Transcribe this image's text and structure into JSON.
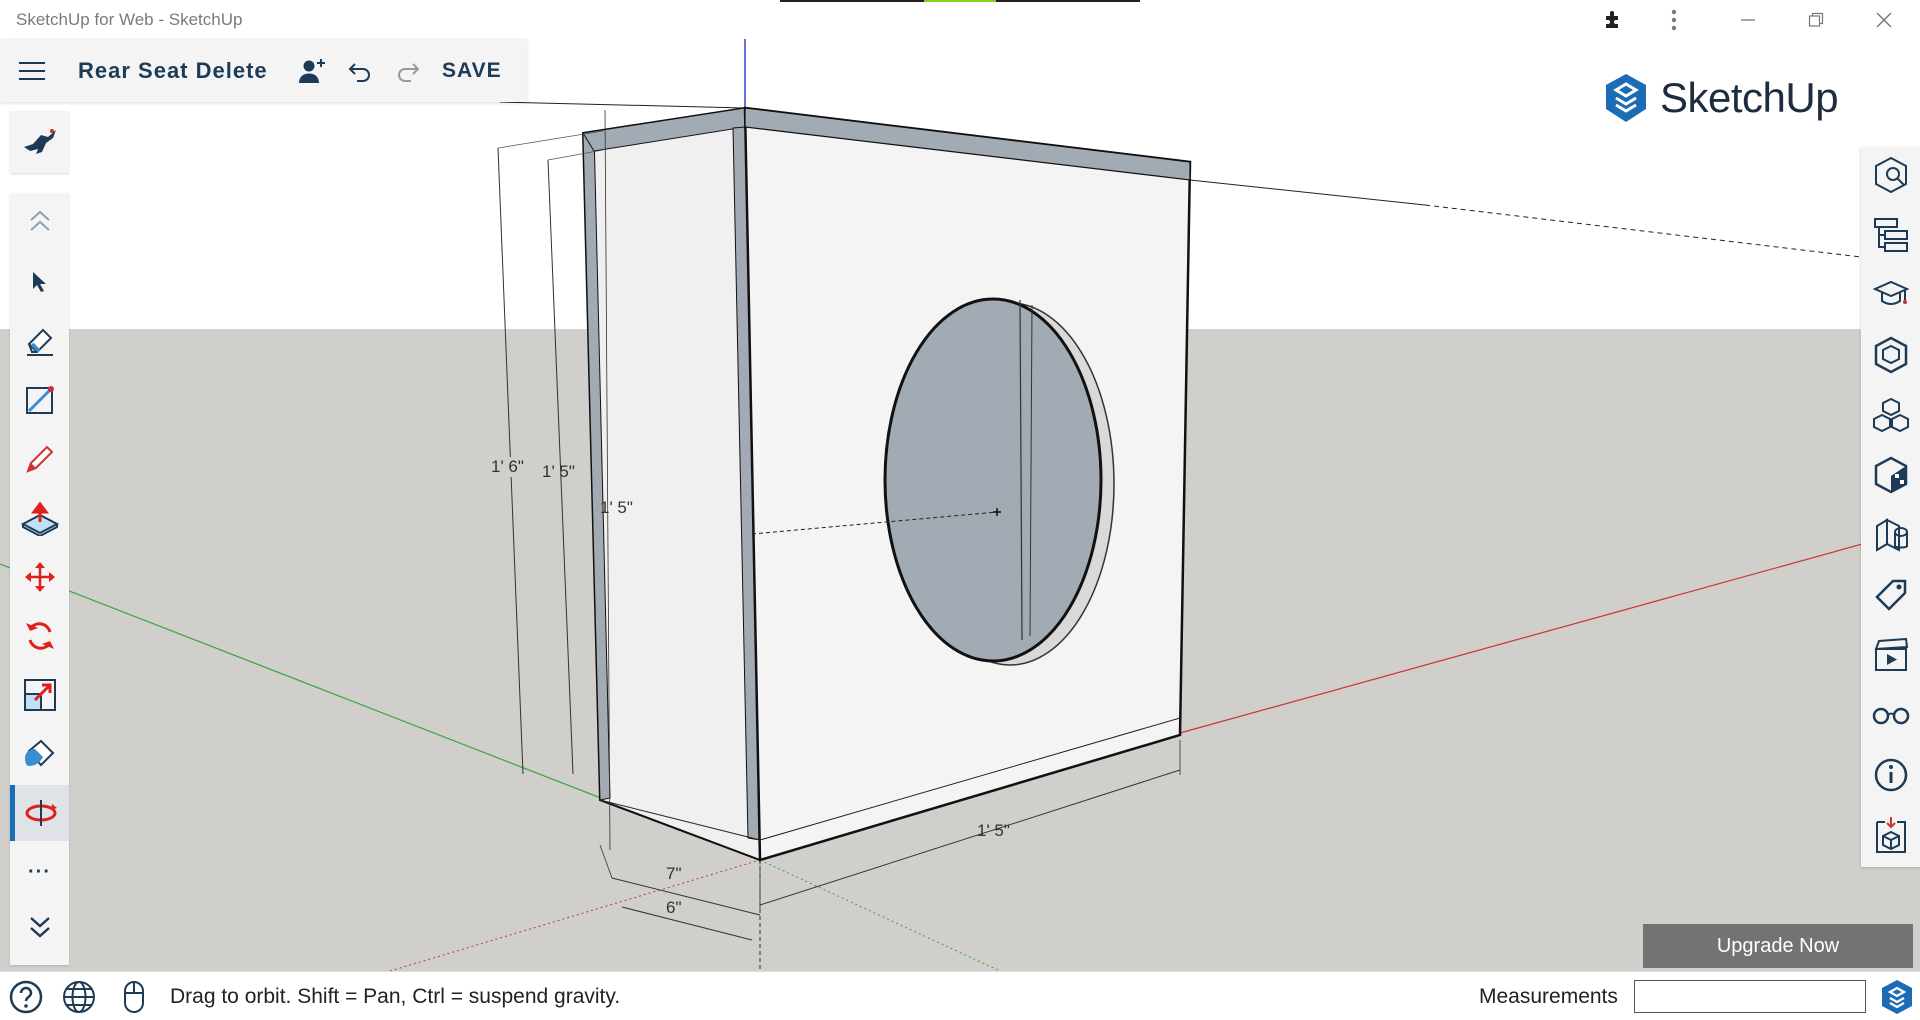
{
  "window": {
    "title": "SketchUp for Web - SketchUp"
  },
  "topbar": {
    "document_title": "Rear Seat Delete",
    "save_label": "SAVE"
  },
  "logo": {
    "text": "SketchUp"
  },
  "left_toolbar": {
    "tools": [
      "search-tool",
      "collapse-up",
      "select",
      "eraser",
      "line",
      "pencil",
      "push-pull",
      "move",
      "rotate",
      "scale",
      "paint-bucket",
      "orbit",
      "more",
      "expand-down"
    ],
    "active_tool": "orbit",
    "more_label": "···"
  },
  "right_panel": {
    "icons": [
      "entity-info-icon",
      "outliner-icon",
      "instructor-icon",
      "components-icon",
      "materials-icon",
      "styles-icon",
      "scenes-icon",
      "tags-icon",
      "animation-icon",
      "display-icon",
      "info-icon",
      "3d-warehouse-icon"
    ]
  },
  "dimensions": {
    "height_outer": "1' 6\"",
    "height_mid": "1' 5\"",
    "height_inner": "1' 5\"",
    "width": "1' 5\"",
    "depth_a": "7\"",
    "depth_b": "6\""
  },
  "upgrade": {
    "label": "Upgrade Now"
  },
  "statusbar": {
    "hint": "Drag to orbit. Shift = Pan, Ctrl = suspend gravity.",
    "measurements_label": "Measurements",
    "measurements_value": ""
  },
  "colors": {
    "sky": "#ffffff",
    "ground": "#d0cfcb",
    "brand_navy": "#1d3b57",
    "accent_blue": "#1a6fb5",
    "axis_red": "#cc2222",
    "axis_green": "#22aa22",
    "axis_blue": "#2233cc",
    "face_white": "#f2f2f2",
    "face_bluegray": "#a2aab3"
  }
}
